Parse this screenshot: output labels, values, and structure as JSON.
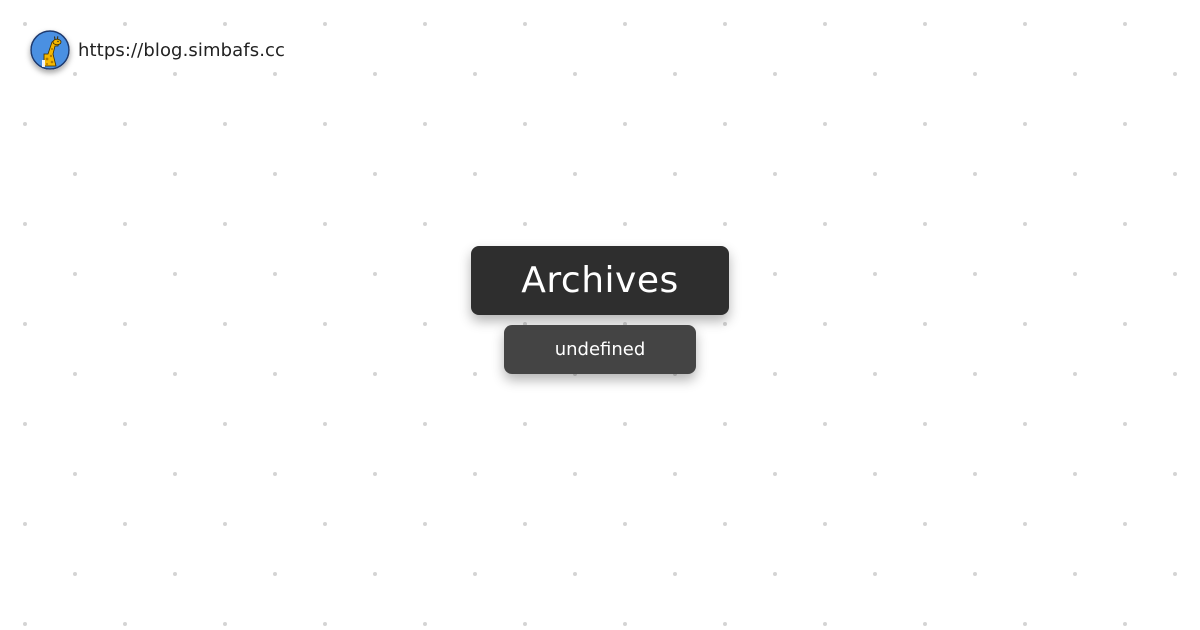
{
  "site": {
    "url": "https://blog.simbafs.cc",
    "avatar_icon": "giraffe-avatar-icon"
  },
  "page": {
    "title": "Archives",
    "subtitle": "undefined"
  },
  "colors": {
    "background": "#ffffff",
    "dot": "#d4d4d4",
    "title_box": "#2e2e2e",
    "subtitle_box": "#444444",
    "text_light": "#ffffff",
    "text_dark": "#222222",
    "avatar_bg": "#4a90e2",
    "giraffe": "#f5b800"
  }
}
